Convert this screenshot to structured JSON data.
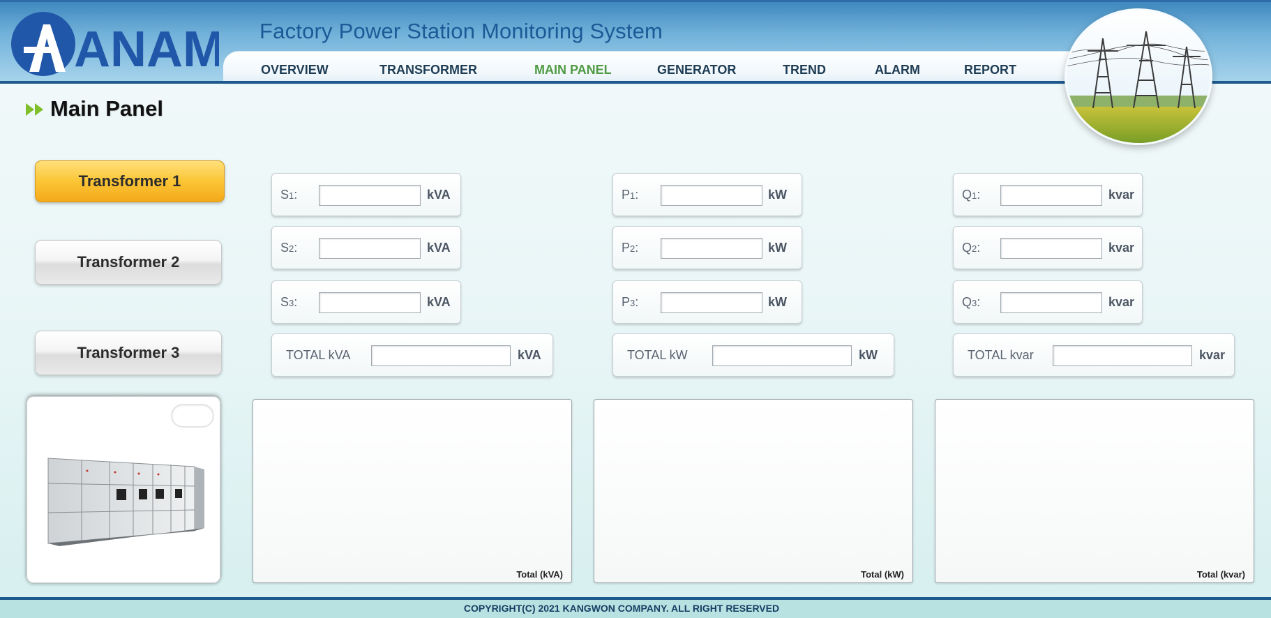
{
  "header": {
    "logo_text": "ANAM",
    "title": "Factory Power Station Monitoring System",
    "colors": {
      "header_blue": "#3f89bf",
      "nav_active": "#4f9b43",
      "title_blue": "#1c5a97"
    },
    "nav": [
      {
        "label": "OVERVIEW",
        "active": false
      },
      {
        "label": "TRANSFORMER",
        "active": false
      },
      {
        "label": "MAIN PANEL",
        "active": true
      },
      {
        "label": "GENERATOR",
        "active": false
      },
      {
        "label": "TREND",
        "active": false
      },
      {
        "label": "ALARM",
        "active": false
      },
      {
        "label": "REPORT",
        "active": false
      }
    ],
    "tower_image_icon": "power-tower-image"
  },
  "page": {
    "title": "Main Panel",
    "title_icon": "double-arrow-icon"
  },
  "transformers": [
    {
      "label": "Transformer 1",
      "active": true
    },
    {
      "label": "Transformer 2",
      "active": false
    },
    {
      "label": "Transformer 3",
      "active": false
    }
  ],
  "equipment_image_icon": "main-panel-cabinet-image",
  "readings": {
    "apparent": {
      "rows": [
        {
          "label": "S",
          "sub": "1",
          "suffix": ":",
          "unit": "kVA",
          "value": ""
        },
        {
          "label": "S",
          "sub": "2",
          "suffix": ":",
          "unit": "kVA",
          "value": ""
        },
        {
          "label": "S",
          "sub": "3",
          "suffix": ":",
          "unit": "kVA",
          "value": ""
        }
      ],
      "total": {
        "label": "TOTAL kVA",
        "unit": "kVA",
        "value": ""
      },
      "chart_label": "Total (kVA)"
    },
    "active": {
      "rows": [
        {
          "label": "P",
          "sub": "1",
          "suffix": ":",
          "unit": "kW",
          "value": ""
        },
        {
          "label": "P",
          "sub": "2",
          "suffix": ":",
          "unit": "kW",
          "value": ""
        },
        {
          "label": "P",
          "sub": "3",
          "suffix": ":",
          "unit": "kW",
          "value": ""
        }
      ],
      "total": {
        "label": "TOTAL kW",
        "unit": "kW",
        "value": ""
      },
      "chart_label": "Total (kW)"
    },
    "reactive": {
      "rows": [
        {
          "label": "Q",
          "sub": "1",
          "suffix": ":",
          "unit": "kvar",
          "value": ""
        },
        {
          "label": "Q",
          "sub": "2",
          "suffix": ":",
          "unit": "kvar",
          "value": ""
        },
        {
          "label": "Q",
          "sub": "3",
          "suffix": ":",
          "unit": "kvar",
          "value": ""
        }
      ],
      "total": {
        "label": "TOTAL kvar",
        "unit": "kvar",
        "value": ""
      },
      "chart_label": "Total (kvar)"
    }
  },
  "footer": {
    "copyright": "COPYRIGHT(C) 2021 KANGWON COMPANY. ALL RIGHT RESERVED"
  }
}
